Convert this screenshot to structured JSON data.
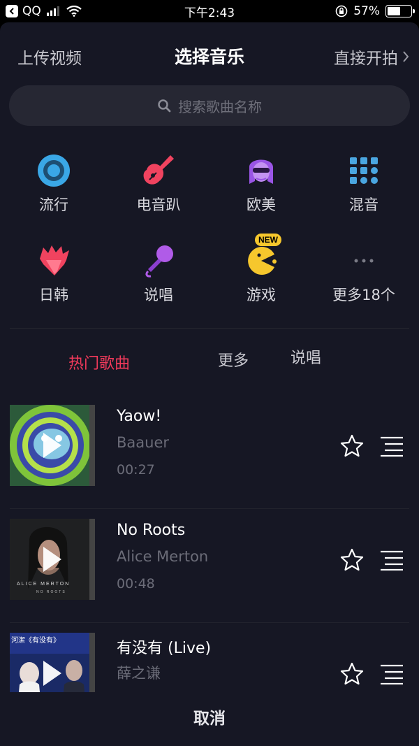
{
  "status_bar": {
    "carrier": "QQ",
    "time": "下午2:43",
    "battery": "57%",
    "battery_level": 0.57
  },
  "header": {
    "left_label": "上传视频",
    "title": "选择音乐",
    "right_label": "直接开拍"
  },
  "search": {
    "placeholder": "搜索歌曲名称"
  },
  "categories": [
    {
      "label": "流行",
      "icon": "pop-disc-icon"
    },
    {
      "label": "电音趴",
      "icon": "electric-guitar-icon"
    },
    {
      "label": "欧美",
      "icon": "sunglasses-avatar-icon"
    },
    {
      "label": "混音",
      "icon": "mixer-grid-icon"
    },
    {
      "label": "日韩",
      "icon": "spiky-hair-icon"
    },
    {
      "label": "说唱",
      "icon": "microphone-icon"
    },
    {
      "label": "游戏",
      "icon": "pacman-icon",
      "badge": "NEW"
    },
    {
      "label": "更多18个",
      "icon": "more-dots-icon"
    }
  ],
  "tabs": [
    {
      "label": "热门歌曲",
      "active": true
    },
    {
      "label": "更多",
      "active": false
    },
    {
      "label": "说唱",
      "active": false
    }
  ],
  "songs": [
    {
      "name": "Yaow!",
      "artist": "Baauer",
      "duration": "00:27"
    },
    {
      "name": "No Roots",
      "artist": "Alice Merton",
      "duration": "00:48",
      "cover_text": [
        "ALICE MERTON",
        "NO ROOTS"
      ]
    },
    {
      "name": "有没有 (Live)",
      "artist": "薛之谦",
      "duration": "",
      "cover_text": [
        "河潔《有没有》"
      ]
    }
  ],
  "footer": {
    "cancel_label": "取消"
  },
  "colors": {
    "sheet_bg": "#161724",
    "accent_red": "#f13a5b",
    "muted_text": "#6b6c78"
  }
}
